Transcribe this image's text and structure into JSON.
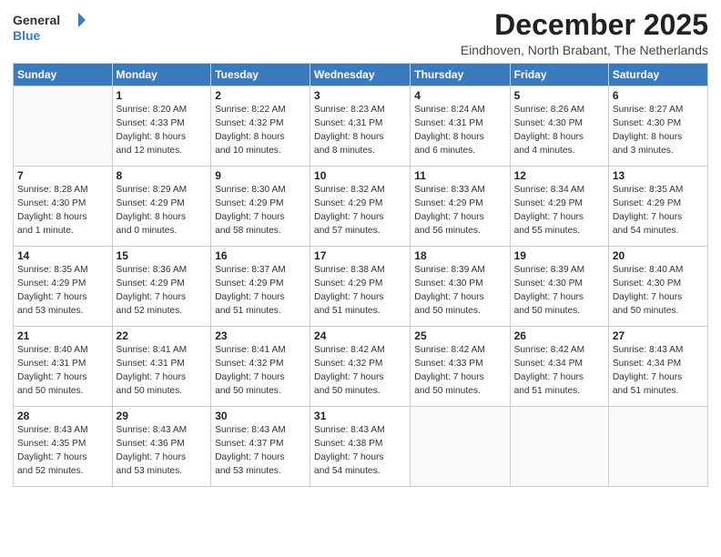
{
  "logo": {
    "general": "General",
    "blue": "Blue"
  },
  "header": {
    "month": "December 2025",
    "location": "Eindhoven, North Brabant, The Netherlands"
  },
  "weekdays": [
    "Sunday",
    "Monday",
    "Tuesday",
    "Wednesday",
    "Thursday",
    "Friday",
    "Saturday"
  ],
  "weeks": [
    [
      {
        "day": "",
        "info": ""
      },
      {
        "day": "1",
        "info": "Sunrise: 8:20 AM\nSunset: 4:33 PM\nDaylight: 8 hours\nand 12 minutes."
      },
      {
        "day": "2",
        "info": "Sunrise: 8:22 AM\nSunset: 4:32 PM\nDaylight: 8 hours\nand 10 minutes."
      },
      {
        "day": "3",
        "info": "Sunrise: 8:23 AM\nSunset: 4:31 PM\nDaylight: 8 hours\nand 8 minutes."
      },
      {
        "day": "4",
        "info": "Sunrise: 8:24 AM\nSunset: 4:31 PM\nDaylight: 8 hours\nand 6 minutes."
      },
      {
        "day": "5",
        "info": "Sunrise: 8:26 AM\nSunset: 4:30 PM\nDaylight: 8 hours\nand 4 minutes."
      },
      {
        "day": "6",
        "info": "Sunrise: 8:27 AM\nSunset: 4:30 PM\nDaylight: 8 hours\nand 3 minutes."
      }
    ],
    [
      {
        "day": "7",
        "info": "Sunrise: 8:28 AM\nSunset: 4:30 PM\nDaylight: 8 hours\nand 1 minute."
      },
      {
        "day": "8",
        "info": "Sunrise: 8:29 AM\nSunset: 4:29 PM\nDaylight: 8 hours\nand 0 minutes."
      },
      {
        "day": "9",
        "info": "Sunrise: 8:30 AM\nSunset: 4:29 PM\nDaylight: 7 hours\nand 58 minutes."
      },
      {
        "day": "10",
        "info": "Sunrise: 8:32 AM\nSunset: 4:29 PM\nDaylight: 7 hours\nand 57 minutes."
      },
      {
        "day": "11",
        "info": "Sunrise: 8:33 AM\nSunset: 4:29 PM\nDaylight: 7 hours\nand 56 minutes."
      },
      {
        "day": "12",
        "info": "Sunrise: 8:34 AM\nSunset: 4:29 PM\nDaylight: 7 hours\nand 55 minutes."
      },
      {
        "day": "13",
        "info": "Sunrise: 8:35 AM\nSunset: 4:29 PM\nDaylight: 7 hours\nand 54 minutes."
      }
    ],
    [
      {
        "day": "14",
        "info": "Sunrise: 8:35 AM\nSunset: 4:29 PM\nDaylight: 7 hours\nand 53 minutes."
      },
      {
        "day": "15",
        "info": "Sunrise: 8:36 AM\nSunset: 4:29 PM\nDaylight: 7 hours\nand 52 minutes."
      },
      {
        "day": "16",
        "info": "Sunrise: 8:37 AM\nSunset: 4:29 PM\nDaylight: 7 hours\nand 51 minutes."
      },
      {
        "day": "17",
        "info": "Sunrise: 8:38 AM\nSunset: 4:29 PM\nDaylight: 7 hours\nand 51 minutes."
      },
      {
        "day": "18",
        "info": "Sunrise: 8:39 AM\nSunset: 4:30 PM\nDaylight: 7 hours\nand 50 minutes."
      },
      {
        "day": "19",
        "info": "Sunrise: 8:39 AM\nSunset: 4:30 PM\nDaylight: 7 hours\nand 50 minutes."
      },
      {
        "day": "20",
        "info": "Sunrise: 8:40 AM\nSunset: 4:30 PM\nDaylight: 7 hours\nand 50 minutes."
      }
    ],
    [
      {
        "day": "21",
        "info": "Sunrise: 8:40 AM\nSunset: 4:31 PM\nDaylight: 7 hours\nand 50 minutes."
      },
      {
        "day": "22",
        "info": "Sunrise: 8:41 AM\nSunset: 4:31 PM\nDaylight: 7 hours\nand 50 minutes."
      },
      {
        "day": "23",
        "info": "Sunrise: 8:41 AM\nSunset: 4:32 PM\nDaylight: 7 hours\nand 50 minutes."
      },
      {
        "day": "24",
        "info": "Sunrise: 8:42 AM\nSunset: 4:32 PM\nDaylight: 7 hours\nand 50 minutes."
      },
      {
        "day": "25",
        "info": "Sunrise: 8:42 AM\nSunset: 4:33 PM\nDaylight: 7 hours\nand 50 minutes."
      },
      {
        "day": "26",
        "info": "Sunrise: 8:42 AM\nSunset: 4:34 PM\nDaylight: 7 hours\nand 51 minutes."
      },
      {
        "day": "27",
        "info": "Sunrise: 8:43 AM\nSunset: 4:34 PM\nDaylight: 7 hours\nand 51 minutes."
      }
    ],
    [
      {
        "day": "28",
        "info": "Sunrise: 8:43 AM\nSunset: 4:35 PM\nDaylight: 7 hours\nand 52 minutes."
      },
      {
        "day": "29",
        "info": "Sunrise: 8:43 AM\nSunset: 4:36 PM\nDaylight: 7 hours\nand 53 minutes."
      },
      {
        "day": "30",
        "info": "Sunrise: 8:43 AM\nSunset: 4:37 PM\nDaylight: 7 hours\nand 53 minutes."
      },
      {
        "day": "31",
        "info": "Sunrise: 8:43 AM\nSunset: 4:38 PM\nDaylight: 7 hours\nand 54 minutes."
      },
      {
        "day": "",
        "info": ""
      },
      {
        "day": "",
        "info": ""
      },
      {
        "day": "",
        "info": ""
      }
    ]
  ]
}
